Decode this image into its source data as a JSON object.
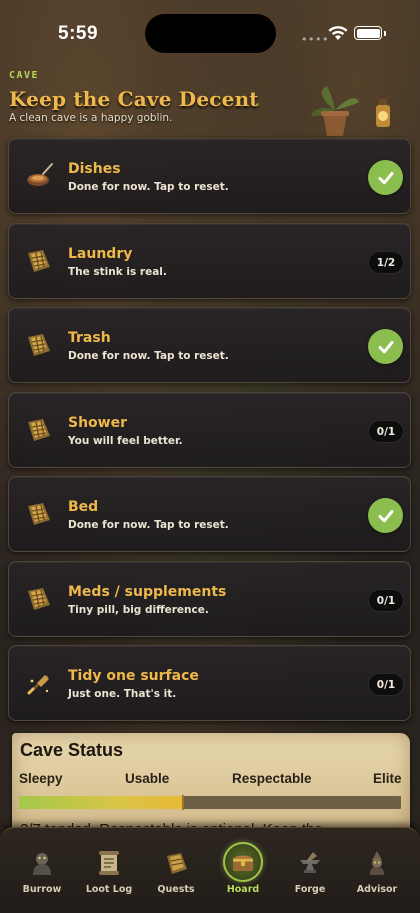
{
  "status_bar": {
    "time": "5:59"
  },
  "header": {
    "eyebrow": "CAVE",
    "title": "Keep the Cave Decent",
    "subtitle": "A clean cave is a happy goblin."
  },
  "chores": [
    {
      "title": "Dishes",
      "subtitle": "Done for now. Tap to reset.",
      "state": "done",
      "icon": "dishes-icon"
    },
    {
      "title": "Laundry",
      "subtitle": "The stink is real.",
      "state": "count",
      "count": "1/2",
      "icon": "laundry-icon"
    },
    {
      "title": "Trash",
      "subtitle": "Done for now. Tap to reset.",
      "state": "done",
      "icon": "trash-icon"
    },
    {
      "title": "Shower",
      "subtitle": "You will feel better.",
      "state": "count",
      "count": "0/1",
      "icon": "shower-icon"
    },
    {
      "title": "Bed",
      "subtitle": "Done for now. Tap to reset.",
      "state": "done",
      "icon": "bed-icon"
    },
    {
      "title": "Meds / supplements",
      "subtitle": "Tiny pill, big difference.",
      "state": "count",
      "count": "0/1",
      "icon": "meds-icon"
    },
    {
      "title": "Tidy one surface",
      "subtitle": "Just one. That's it.",
      "state": "count",
      "count": "0/1",
      "icon": "tidy-icon"
    }
  ],
  "cave_status": {
    "title": "Cave Status",
    "levels": [
      "Sleepy",
      "Usable",
      "Respectable",
      "Elite"
    ],
    "progress_fraction": 0.43,
    "tended_text": "3/7 tended. Respectable is optional. Keep the"
  },
  "tabs": [
    {
      "label": "Burrow",
      "icon": "burrow-icon",
      "active": false
    },
    {
      "label": "Loot Log",
      "icon": "scroll-icon",
      "active": false
    },
    {
      "label": "Quests",
      "icon": "quests-icon",
      "active": false
    },
    {
      "label": "Hoard",
      "icon": "treasure-chest-icon",
      "active": true
    },
    {
      "label": "Forge",
      "icon": "anvil-icon",
      "active": false
    },
    {
      "label": "Advisor",
      "icon": "advisor-icon",
      "active": false
    }
  ],
  "colors": {
    "accent_gold": "#efb84b",
    "accent_green": "#8bbe4e",
    "eyebrow_green": "#b7d65a",
    "card_bg": "#28242a"
  }
}
